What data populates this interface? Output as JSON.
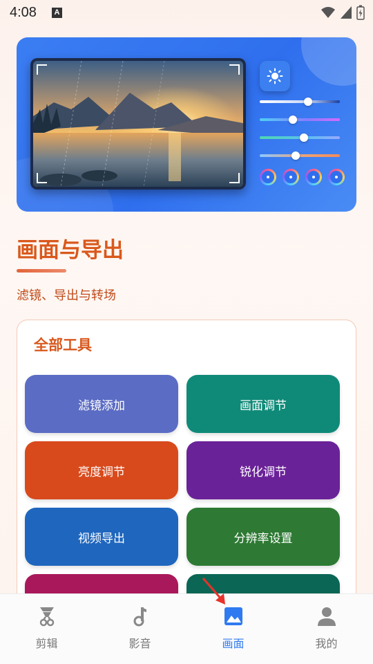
{
  "status_bar": {
    "time": "4:08",
    "notification_icon": "A"
  },
  "banner": {
    "icons": [
      "photo-preview",
      "sun-icon",
      "sliders",
      "color-dials"
    ],
    "sliders": [
      {
        "level": 0.6,
        "track": "#c7d6f7"
      },
      {
        "level": 0.4,
        "track": "#5fd3f0"
      },
      {
        "level": 0.55,
        "track": "#4fd7b0"
      },
      {
        "level": 0.45,
        "track": "#f0a070"
      }
    ]
  },
  "page": {
    "title": "画面与导出",
    "subtitle": "滤镜、导出与转场"
  },
  "tools": {
    "title": "全部工具",
    "items": [
      {
        "label": "滤镜添加",
        "color": "#5b6cc4"
      },
      {
        "label": "画面调节",
        "color": "#0f8a78"
      },
      {
        "label": "亮度调节",
        "color": "#d84a1c"
      },
      {
        "label": "锐化调节",
        "color": "#6a2298"
      },
      {
        "label": "视频导出",
        "color": "#1f66be"
      },
      {
        "label": "分辨率设置",
        "color": "#2e7a34"
      },
      {
        "label": "",
        "color": "#a9185a"
      },
      {
        "label": "",
        "color": "#0c6655"
      }
    ]
  },
  "bottom_nav": {
    "items": [
      {
        "label": "剪辑",
        "icon": "clip-icon"
      },
      {
        "label": "影音",
        "icon": "music-note-icon"
      },
      {
        "label": "画面",
        "icon": "image-icon",
        "active": true
      },
      {
        "label": "我的",
        "icon": "person-icon"
      }
    ]
  },
  "colors": {
    "accent": "#d9581c",
    "nav_active": "#2f7af0"
  }
}
